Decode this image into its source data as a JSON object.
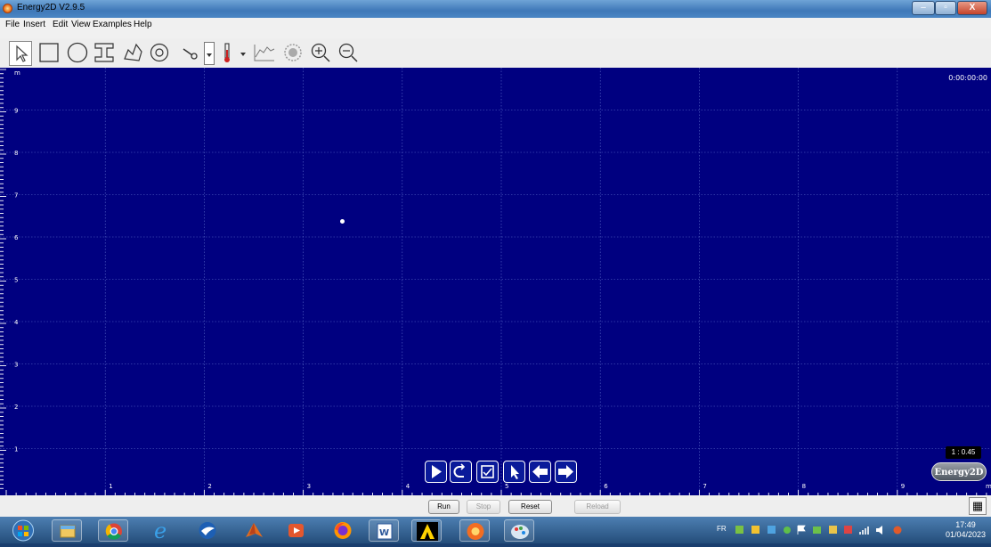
{
  "window": {
    "title": "Energy2D V2.9.5",
    "min_label": "–",
    "max_label": "▫",
    "close_label": "X"
  },
  "menu": {
    "items": [
      "File",
      "Insert",
      "Edit",
      "View",
      "Examples",
      "Help"
    ]
  },
  "toolbar": {
    "icons": [
      "select-arrow-icon",
      "rectangle-icon",
      "ellipse-icon",
      "i-beam-icon",
      "blob-icon",
      "ring-icon",
      "heater-icon",
      "dropdown-arrow-icon",
      "thermometer-icon",
      "dropdown-arrow-icon",
      "graph-icon",
      "heat-flux-icon",
      "zoom-in-icon",
      "zoom-out-icon"
    ]
  },
  "canvas": {
    "background": "#000080",
    "time": "0:00:00:00",
    "y_unit": "m",
    "x_unit": "m",
    "y_ticks": [
      "9",
      "8",
      "7",
      "6",
      "5",
      "4",
      "3",
      "2",
      "1"
    ],
    "x_ticks": [
      "1",
      "2",
      "3",
      "4",
      "5",
      "6",
      "7",
      "8",
      "9"
    ],
    "scale_label": "1 : 0.45",
    "logo": "Energy2D",
    "controls": [
      "play-icon",
      "undo-icon",
      "checkbox-icon",
      "cursor-icon",
      "arrow-left-icon",
      "arrow-right-icon"
    ]
  },
  "bottom": {
    "run": "Run",
    "stop": "Stop",
    "reset": "Reset",
    "reload": "Reload"
  },
  "taskbar": {
    "apps": [
      "start-orb-icon",
      "explorer-icon",
      "chrome-icon",
      "ie-icon",
      "app-bird-icon",
      "matlab-icon",
      "media-player-icon",
      "firefox-icon",
      "word-icon",
      "arrow-app-icon",
      "energy2d-icon",
      "paint-icon"
    ],
    "lang": "FR",
    "time": "17:49",
    "date": "01/04/2023"
  }
}
